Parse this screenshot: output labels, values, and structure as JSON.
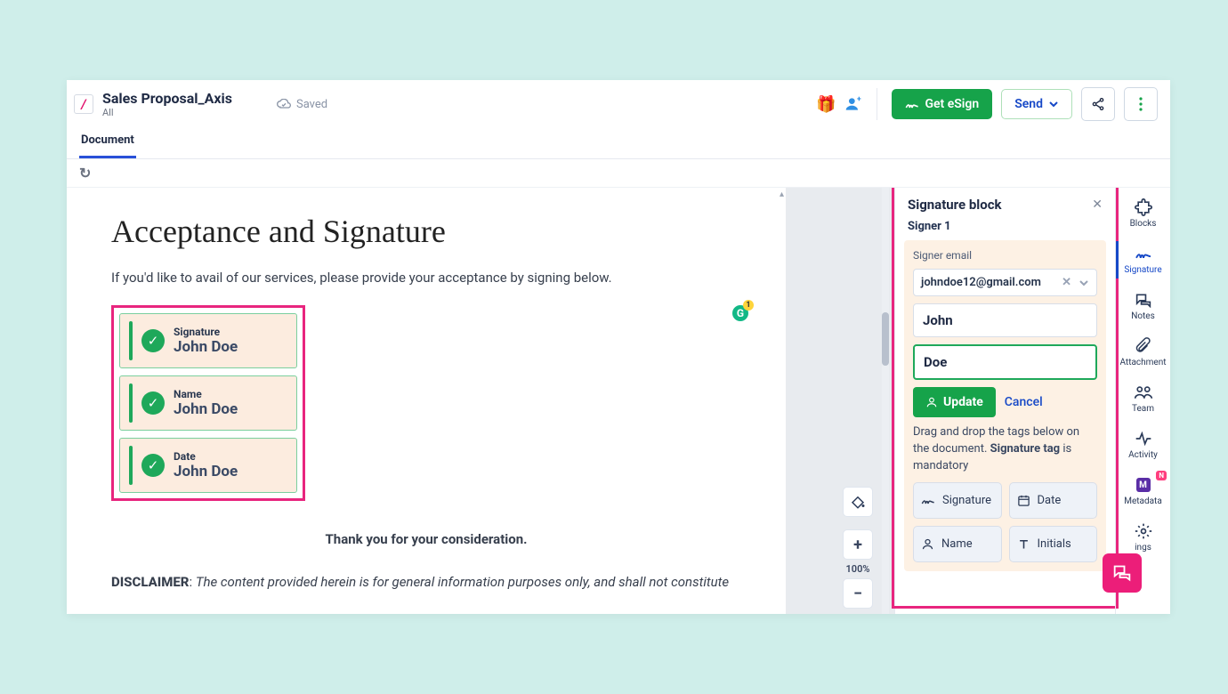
{
  "header": {
    "logo_char": "/",
    "title": "Sales Proposal_Axis",
    "subtitle": "All",
    "saved_label": "Saved",
    "get_esign_label": "Get eSign",
    "send_label": "Send"
  },
  "tabs": {
    "document": "Document"
  },
  "document": {
    "heading": "Acceptance and Signature",
    "intro": "If you'd like to avail of our services, please provide your acceptance by signing below.",
    "sig_blocks": [
      {
        "label": "Signature",
        "value": "John Doe"
      },
      {
        "label": "Name",
        "value": "John Doe"
      },
      {
        "label": "Date",
        "value": "John Doe"
      }
    ],
    "thankyou": "Thank you for your consideration.",
    "disclaimer_label": "DISCLAIMER",
    "disclaimer_text": "The content provided herein is for general information purposes only, and shall not constitute"
  },
  "zoom": {
    "value": "100%"
  },
  "panel": {
    "title": "Signature block",
    "signer_label": "Signer 1",
    "email_label": "Signer email",
    "email_value": "johndoe12@gmail.com",
    "first_name": "John",
    "last_name": "Doe",
    "update_label": "Update",
    "cancel_label": "Cancel",
    "hint_pre": "Drag and drop the tags below on the document. ",
    "hint_bold": "Signature tag",
    "hint_post": " is mandatory",
    "tags": {
      "signature": "Signature",
      "date": "Date",
      "name": "Name",
      "initials": "Initials"
    }
  },
  "rail": {
    "blocks": "Blocks",
    "signature": "Signature",
    "notes": "Notes",
    "attachment": "Attachment",
    "team": "Team",
    "activity": "Activity",
    "metadata": "Metadata",
    "settings": "ings",
    "new_badge": "N"
  }
}
